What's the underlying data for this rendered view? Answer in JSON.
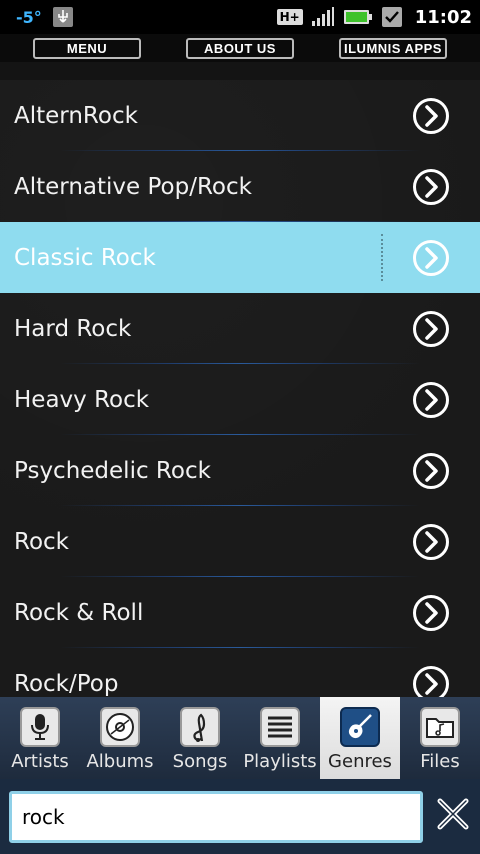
{
  "status": {
    "temperature": "-5°",
    "network": "H+",
    "time": "11:02"
  },
  "topmenu": {
    "menu": "MENU",
    "about": "ABOUT US",
    "apps": "ILUMNIS APPS"
  },
  "genres": [
    {
      "label": "AlternRock",
      "selected": false
    },
    {
      "label": "Alternative Pop/Rock",
      "selected": false
    },
    {
      "label": "Classic Rock",
      "selected": true
    },
    {
      "label": "Hard Rock",
      "selected": false
    },
    {
      "label": "Heavy Rock",
      "selected": false
    },
    {
      "label": "Psychedelic Rock",
      "selected": false
    },
    {
      "label": "Rock",
      "selected": false
    },
    {
      "label": "Rock & Roll",
      "selected": false
    },
    {
      "label": "Rock/Pop",
      "selected": false
    }
  ],
  "tabs": [
    {
      "label": "Artists",
      "icon": "microphone-icon",
      "active": false
    },
    {
      "label": "Albums",
      "icon": "disc-icon",
      "active": false
    },
    {
      "label": "Songs",
      "icon": "treble-clef-icon",
      "active": false
    },
    {
      "label": "Playlists",
      "icon": "playlist-icon",
      "active": false
    },
    {
      "label": "Genres",
      "icon": "guitar-icon",
      "active": true
    },
    {
      "label": "Files",
      "icon": "folder-icon",
      "active": false
    }
  ],
  "search": {
    "value": "rock"
  },
  "colors": {
    "selected_row": "#8fdcef",
    "tab_bar": "#2e3f57",
    "accent": "#3fb6ff"
  }
}
